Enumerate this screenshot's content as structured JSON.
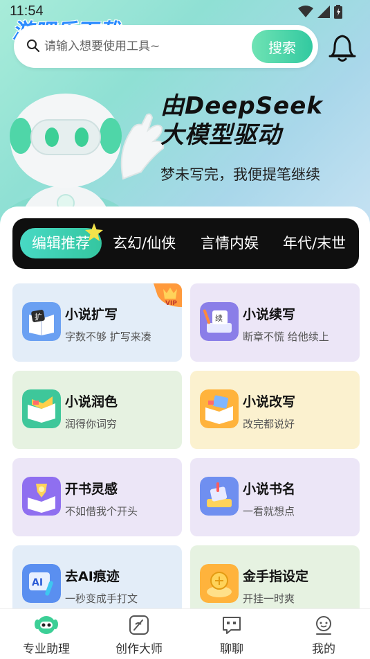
{
  "status_bar": {
    "time": "11:54"
  },
  "watermark": {
    "text": "游吧乐下载"
  },
  "search": {
    "placeholder": "请输入想要使用工具~",
    "button_label": "搜索"
  },
  "hero": {
    "title_line1": "由DeepSeek",
    "title_line2": "大模型驱动",
    "subtitle": "梦未写完，我便提笔继续"
  },
  "tabs": [
    {
      "label": "编辑推荐",
      "active": true
    },
    {
      "label": "玄幻/仙侠"
    },
    {
      "label": "言情内娱"
    },
    {
      "label": "年代/末世"
    }
  ],
  "tools": [
    {
      "title": "小说扩写",
      "desc": "字数不够 扩写来凑",
      "icon": "book-expand-icon",
      "bg": "#e3edf8",
      "badge": "VIP"
    },
    {
      "title": "小说续写",
      "desc": "断章不慌 给他续上",
      "icon": "book-continue-icon",
      "bg": "#ece6f7"
    },
    {
      "title": "小说润色",
      "desc": "润得你词穷",
      "icon": "book-polish-icon",
      "bg": "#e6f2e1"
    },
    {
      "title": "小说改写",
      "desc": "改完都说好",
      "icon": "book-rewrite-icon",
      "bg": "#fbf1cf"
    },
    {
      "title": "开书灵感",
      "desc": "不如借我个开头",
      "icon": "inspiration-icon",
      "bg": "#ece6f7"
    },
    {
      "title": "小说书名",
      "desc": "一看就想点",
      "icon": "book-title-icon",
      "bg": "#ece6f7"
    },
    {
      "title": "去AI痕迹",
      "desc": "一秒变成手打文",
      "icon": "remove-ai-icon",
      "bg": "#e3edf8"
    },
    {
      "title": "金手指设定",
      "desc": "开挂一时爽",
      "icon": "golden-finger-icon",
      "bg": "#e6f2e1"
    }
  ],
  "bottom_nav": [
    {
      "label": "专业助理",
      "icon": "robot-assistant-icon",
      "active": true
    },
    {
      "label": "创作大师",
      "icon": "creation-master-icon"
    },
    {
      "label": "聊聊",
      "icon": "chat-icon"
    },
    {
      "label": "我的",
      "icon": "profile-icon"
    }
  ],
  "colors": {
    "accent": "#34c6a0",
    "tab_strip": "#0f0f0f"
  }
}
